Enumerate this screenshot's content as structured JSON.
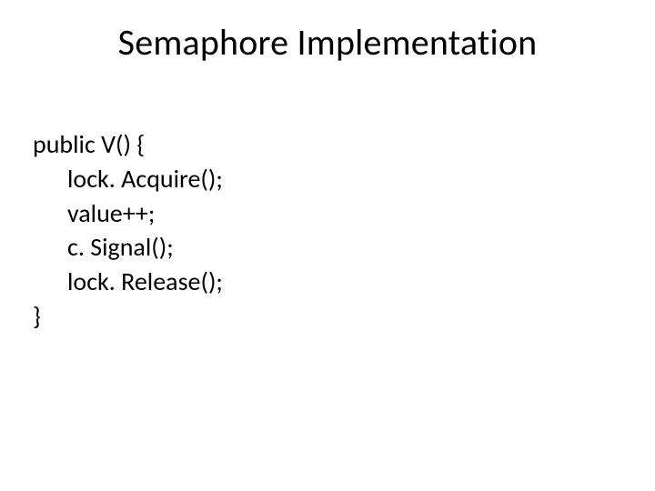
{
  "slide": {
    "title": "Semaphore Implementation",
    "code": {
      "line1": "public V() {",
      "line2": "lock. Acquire();",
      "line3": "value++;",
      "line4": "c. Signal();",
      "line5": "lock. Release();",
      "line6": "}"
    }
  }
}
